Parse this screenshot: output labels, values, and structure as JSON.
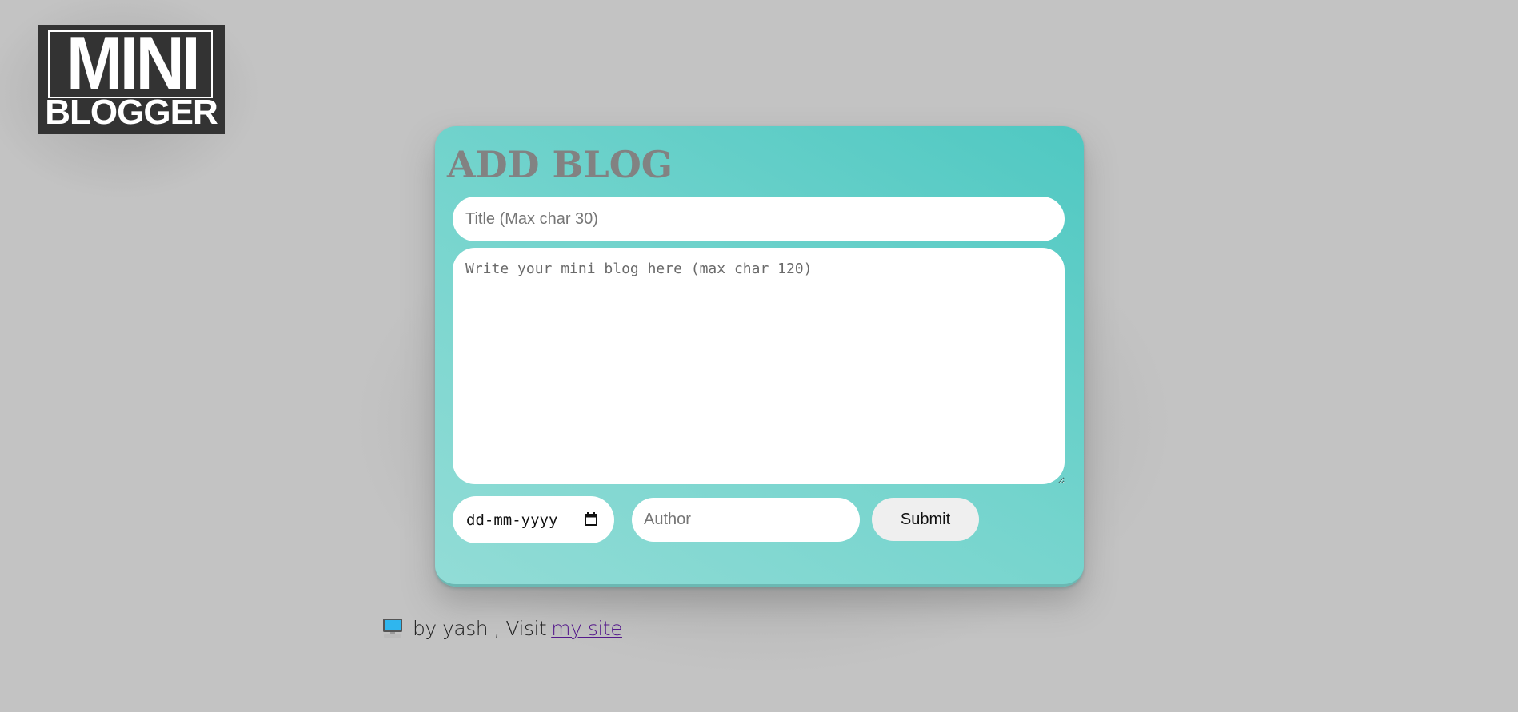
{
  "logo": {
    "line1": "MINI",
    "line2": "BLOGGER"
  },
  "form": {
    "heading": "ADD BLOG",
    "title_placeholder": "Title (Max char 30)",
    "body_placeholder": "Write your mini blog here (max char 120)",
    "date_value": "dd-mm-yyyy",
    "author_placeholder": "Author",
    "submit_label": "Submit"
  },
  "footer": {
    "icon": "computer-icon",
    "text": "by yash , Visit",
    "link_text": "my site"
  },
  "colors": {
    "background": "#c3c3c3",
    "card_accent": "#4fc8c2",
    "heading": "#828282",
    "link": "#551a8b"
  }
}
